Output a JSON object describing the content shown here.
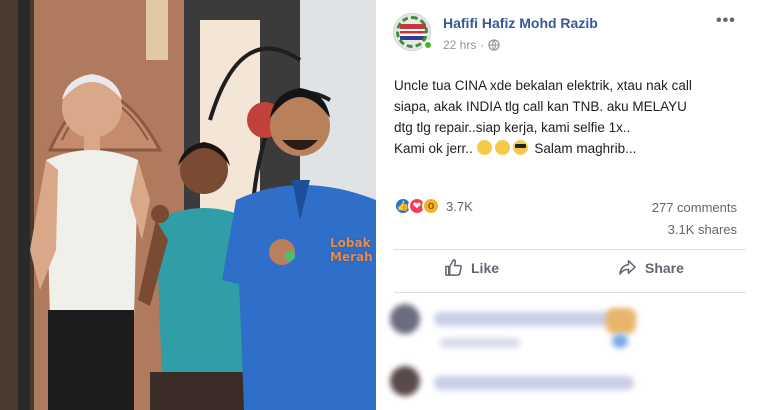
{
  "photo": {
    "watermark": "Lobak Merah"
  },
  "post": {
    "author": "Hafifi Hafiz Mohd Razib",
    "time": "22 hrs",
    "text_lines": [
      "Uncle tua CINA xde bekalan elektrik, xtau nak call",
      "siapa, akak INDIA tlg call kan TNB. aku MELAYU",
      "dtg tlg repair..siap kerja, kami selfie 1x..",
      "Kami ok jerr.."
    ],
    "text_tail": "Salam maghrib...",
    "reaction_count": "3.7K",
    "comments_label": "277 comments",
    "shares_label": "3.1K shares",
    "like_label": "Like",
    "share_label": "Share",
    "reaction_icons": [
      "like-icon",
      "love-icon",
      "wow-icon"
    ],
    "emoji_icons": [
      "pensive-face-icon",
      "pensive-face-icon",
      "sunglasses-face-icon"
    ]
  },
  "colors": {
    "author_link": "#385898",
    "like_blue": "#1877f2",
    "love_red": "#f33e58",
    "wow_yellow": "#f7b125",
    "online_green": "#42b72a",
    "watermark_orange": "#e9894a"
  }
}
